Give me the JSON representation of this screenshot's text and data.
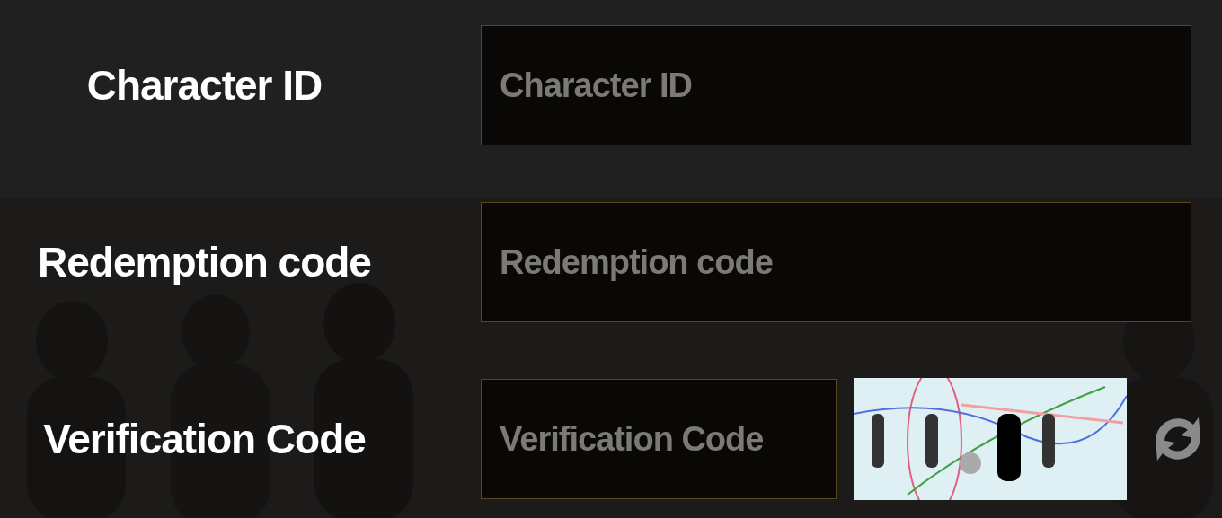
{
  "fields": [
    {
      "kind": "text",
      "label": "Character ID",
      "placeholder": "Character ID"
    },
    {
      "kind": "text",
      "label": "Redemption code",
      "placeholder": "Redemption code"
    },
    {
      "kind": "captcha",
      "label": "Verification Code",
      "placeholder": "Verification Code"
    }
  ]
}
